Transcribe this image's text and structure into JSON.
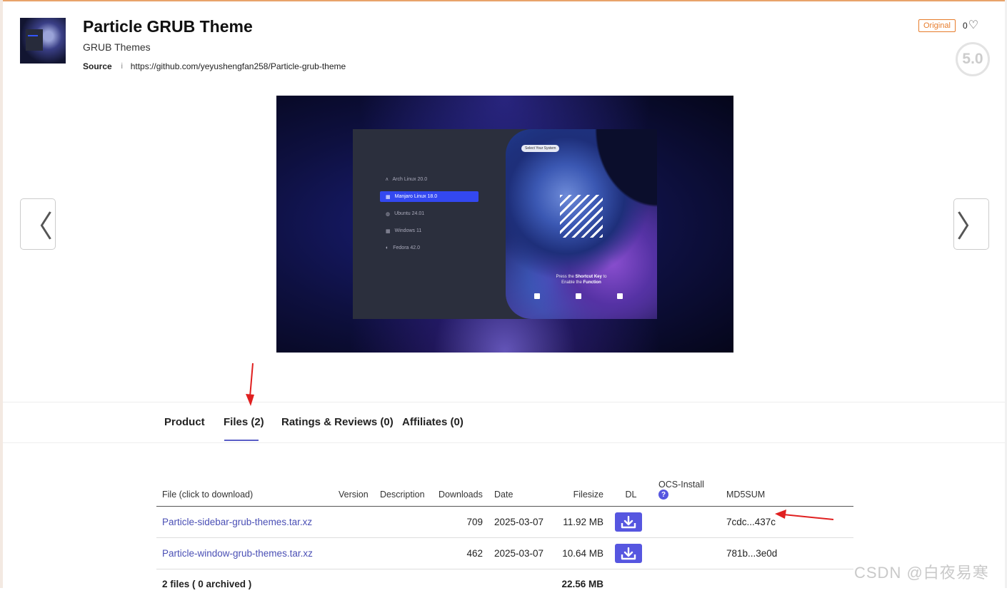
{
  "product": {
    "title": "Particle GRUB Theme",
    "category": "GRUB Themes",
    "source_label": "Source",
    "source_info_icon": "info-icon",
    "source_url": "https://github.com/yeyushengfan258/Particle-grub-theme",
    "badge": "Original",
    "likes": "0",
    "rating": "5.0"
  },
  "carousel": {
    "prev_glyph": "〈",
    "next_glyph": "〉",
    "grub_menu": [
      {
        "icon": "ᴧ",
        "label": "Arch Linux 20.0"
      },
      {
        "icon": "▦",
        "label": "Manjaro Linux 18.0",
        "selected": true
      },
      {
        "icon": "◍",
        "label": "Ubuntu 24.01"
      },
      {
        "icon": "▦",
        "label": "Windows 11"
      },
      {
        "icon": "◐",
        "label": "Fedora 42.0"
      }
    ],
    "grub_chip": "Select Your System",
    "grub_hint_1": "Press the",
    "grub_hint_key": "Shortcut Key",
    "grub_hint_2": "to",
    "grub_hint_3": "Enable the",
    "grub_hint_func": "Function"
  },
  "tabs": [
    {
      "label": "Product"
    },
    {
      "label": "Files (2)",
      "active": true
    },
    {
      "label": "Ratings & Reviews (0)"
    },
    {
      "label": "Affiliates (0)"
    }
  ],
  "files_table": {
    "headers": {
      "file": "File (click to download)",
      "version": "Version",
      "description": "Description",
      "downloads": "Downloads",
      "date": "Date",
      "filesize": "Filesize",
      "dl": "DL",
      "ocs": "OCS-Install",
      "ocs_help": "?",
      "md5": "MD5SUM"
    },
    "rows": [
      {
        "file": "Particle-sidebar-grub-themes.tar.xz",
        "version": "",
        "description": "",
        "downloads": "709",
        "date": "2025-03-07",
        "filesize": "11.92 MB",
        "md5": "7cdc...437c"
      },
      {
        "file": "Particle-window-grub-themes.tar.xz",
        "version": "",
        "description": "",
        "downloads": "462",
        "date": "2025-03-07",
        "filesize": "10.64 MB",
        "md5": "781b...3e0d"
      }
    ],
    "total_label": "2 files ( 0 archived )",
    "total_size": "22.56 MB"
  },
  "annotations": {
    "arrow_color": "#e02020"
  },
  "watermark": "CSDN @白夜易寒",
  "colors": {
    "accent": "#5656e0",
    "link": "#4a4fb5",
    "badge": "#e77c2b"
  }
}
